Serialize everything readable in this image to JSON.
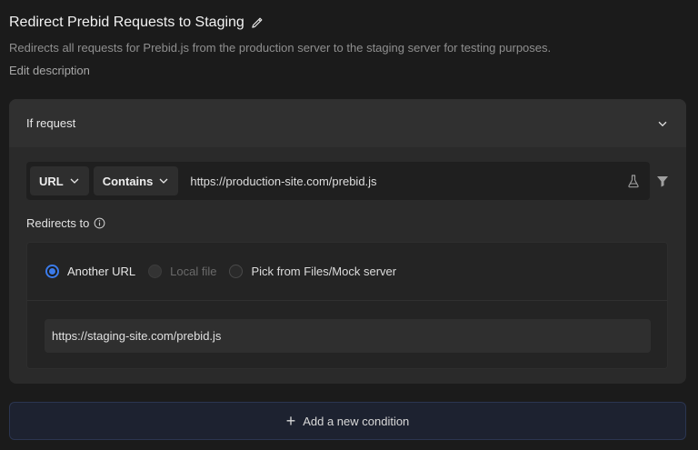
{
  "rule": {
    "title": "Redirect Prebid Requests to Staging",
    "description": "Redirects all requests for Prebid.js from the production server to the staging server for testing purposes.",
    "edit_description_label": "Edit description"
  },
  "condition": {
    "header_label": "If request",
    "source_key": "URL",
    "operator": "Contains",
    "value": "https://production-site.com/prebid.js"
  },
  "redirect": {
    "label": "Redirects to",
    "options": [
      {
        "label": "Another URL",
        "selected": true,
        "disabled": false
      },
      {
        "label": "Local file",
        "selected": false,
        "disabled": true
      },
      {
        "label": "Pick from Files/Mock server",
        "selected": false,
        "disabled": false
      }
    ],
    "destination_url": "https://staging-site.com/prebid.js"
  },
  "actions": {
    "add_condition_label": "Add a new condition"
  },
  "colors": {
    "accent": "#3b7bea",
    "background": "#1b1b1b",
    "card": "#2a2a2a"
  },
  "icons": [
    "pencil-icon",
    "chevron-down-icon",
    "flask-icon",
    "filter-icon",
    "info-icon",
    "plus-icon"
  ]
}
